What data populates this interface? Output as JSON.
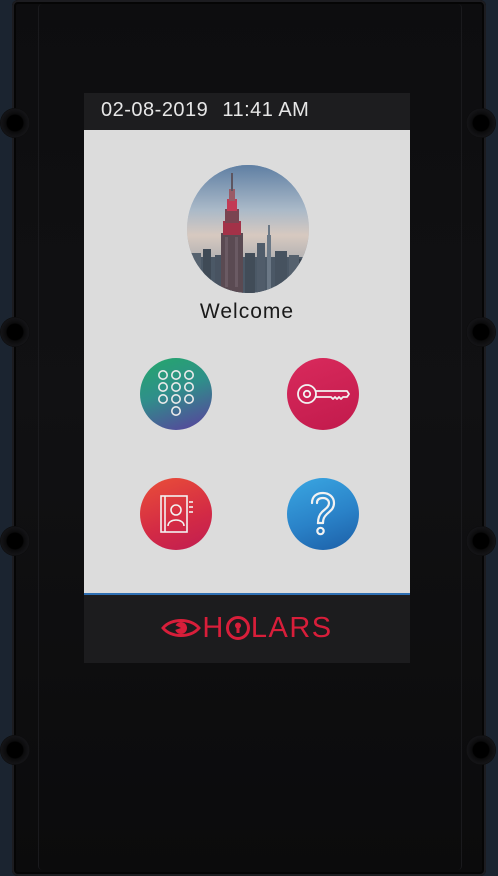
{
  "status_bar": {
    "date": "02-08-2019",
    "time": "11:41 AM"
  },
  "main": {
    "welcome": "Welcome",
    "tiles": [
      {
        "name": "keypad",
        "icon": "keypad-icon",
        "color_start": "#2f9e6a",
        "color_end": "#5a3e9c"
      },
      {
        "name": "key",
        "icon": "key-icon",
        "color_start": "#d0265a",
        "color_end": "#b0174a"
      },
      {
        "name": "directory",
        "icon": "contact-book-icon",
        "color_start": "#e8473a",
        "color_end": "#c51e4e"
      },
      {
        "name": "help",
        "icon": "question-mark-icon",
        "color_start": "#35a0de",
        "color_end": "#1a5fa8"
      }
    ]
  },
  "footer": {
    "brand_pre": "H",
    "brand_post": "LARS",
    "brand_color": "#d81e3a",
    "accent_line_color": "#2e6fb3"
  }
}
